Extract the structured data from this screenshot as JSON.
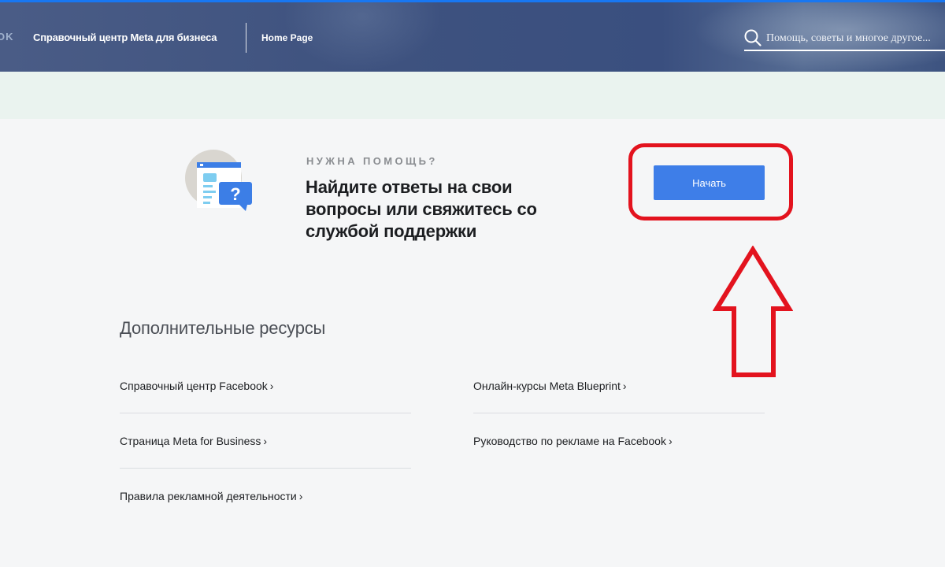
{
  "header": {
    "brand_fragment": "OK",
    "site_title": "Справочный центр Meta для бизнеса",
    "home_link": "Home Page",
    "search_placeholder": "Помощь, советы и многое другое..."
  },
  "help": {
    "eyebrow": "НУЖНА ПОМОЩЬ?",
    "title": "Найдите ответы на свои вопросы или свяжитесь со службой поддержки",
    "start_button": "Начать"
  },
  "resources": {
    "title": "Дополнительные ресурсы",
    "links": [
      "Справочный центр Facebook",
      "Онлайн-курсы Meta Blueprint",
      "Страница Meta for Business",
      "Руководство по рекламе на Facebook",
      "Правила рекламной деятельности"
    ],
    "chevron": "›"
  },
  "colors": {
    "accent": "#3e7ee8",
    "annotation": "#e3131e",
    "header": "#3e527f"
  }
}
